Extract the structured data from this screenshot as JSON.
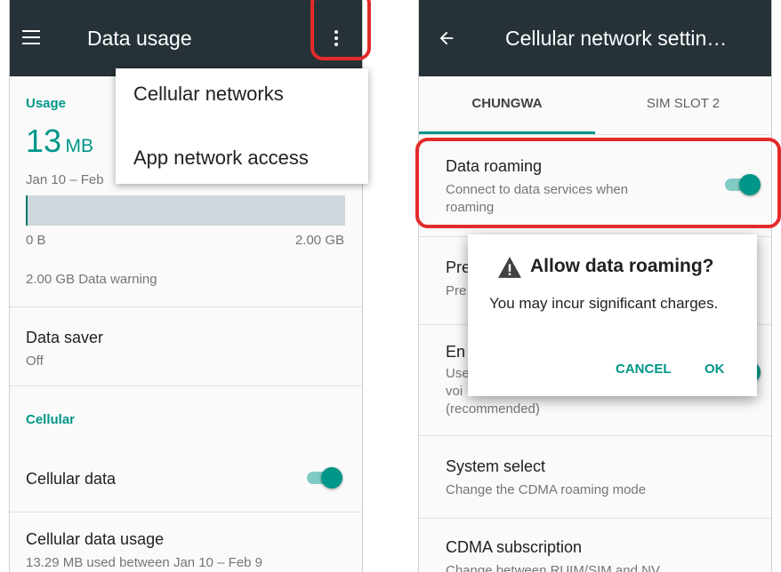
{
  "left": {
    "appbar": {
      "title": "Data usage",
      "menu_icon": "hamburger-menu-icon",
      "overflow_icon": "more-vert-icon"
    },
    "usage": {
      "section_label": "Usage",
      "amount": "13",
      "unit": "MB",
      "range": "Jan 10 – Feb",
      "bar_fraction": 0.0065,
      "min_label": "0 B",
      "max_label": "2.00 GB",
      "warning": "2.00 GB Data warning"
    },
    "data_saver": {
      "title": "Data saver",
      "value": "Off"
    },
    "cellular": {
      "section_label": "Cellular",
      "cellular_data": {
        "title": "Cellular data",
        "enabled": true
      },
      "cellular_data_usage": {
        "title": "Cellular data usage",
        "summary": "13.29 MB used between Jan 10 – Feb 9"
      }
    },
    "overflow_menu": [
      "Cellular networks",
      "App network access"
    ]
  },
  "right": {
    "appbar": {
      "title": "Cellular network settin…",
      "back_icon": "arrow-back-icon"
    },
    "tabs": [
      {
        "label": "CHUNGWA",
        "selected": true
      },
      {
        "label": "SIM SLOT 2",
        "selected": false
      }
    ],
    "data_roaming": {
      "title": "Data roaming",
      "summary_line1": "Connect to data services when",
      "summary_line2": "roaming",
      "enabled": true
    },
    "preferred": {
      "title_fragment": "Pre",
      "sub_fragment": "Pre"
    },
    "enhanced": {
      "title_fragment": "En",
      "sub_line1": "Use",
      "sub_line2": "voi",
      "sub_line3": "(recommended)"
    },
    "system_select": {
      "title": "System select",
      "summary": "Change the CDMA roaming mode"
    },
    "cdma_subscription": {
      "title": "CDMA subscription",
      "summary": "Change between RUIM/SIM and NV"
    },
    "dialog": {
      "icon": "warning-icon",
      "title": "Allow data roaming?",
      "message": "You may incur significant charges.",
      "cancel": "CANCEL",
      "ok": "OK"
    }
  },
  "colors": {
    "appbar": "#263238",
    "accent": "#009688",
    "highlight": "#e32b2b"
  }
}
